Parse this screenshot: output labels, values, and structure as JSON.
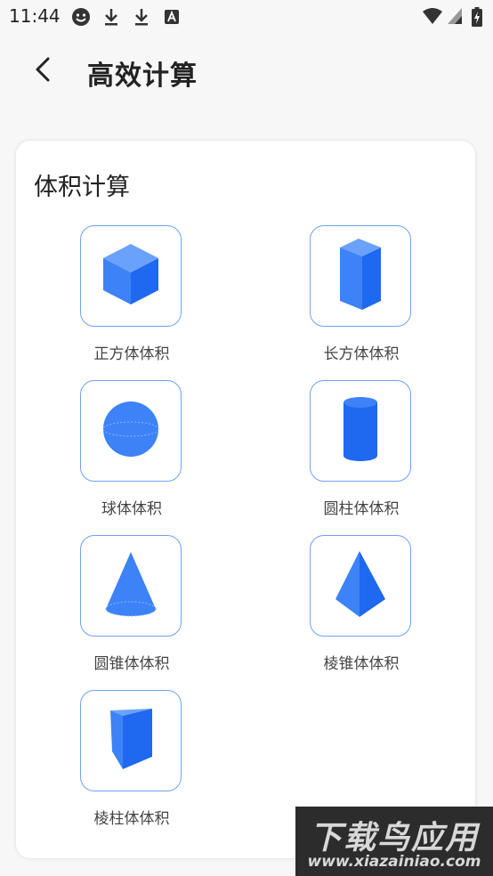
{
  "status_bar": {
    "time": "11:44"
  },
  "header": {
    "title": "高效计算"
  },
  "card": {
    "title": "体积计算",
    "items": [
      {
        "label": "正方体体积",
        "icon": "cube-icon"
      },
      {
        "label": "长方体体积",
        "icon": "cuboid-icon"
      },
      {
        "label": "球体体积",
        "icon": "sphere-icon"
      },
      {
        "label": "圆柱体体积",
        "icon": "cylinder-icon"
      },
      {
        "label": "圆锥体体积",
        "icon": "cone-icon"
      },
      {
        "label": "棱锥体体积",
        "icon": "pyramid-icon"
      },
      {
        "label": "棱柱体体积",
        "icon": "prism-icon"
      }
    ]
  },
  "watermark": {
    "top": "下载鸟应用",
    "bottom": "www.xiazainiao.com"
  },
  "colors": {
    "accent": "#3d82f7",
    "border": "#6fa1f5"
  }
}
